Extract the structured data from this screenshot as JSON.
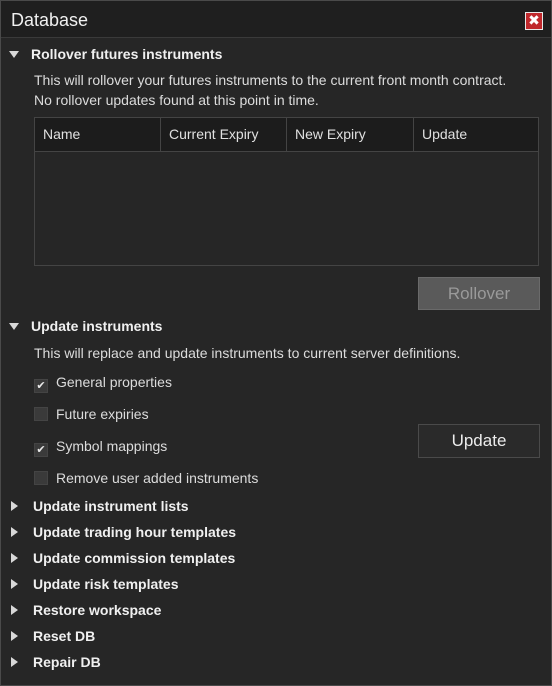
{
  "window": {
    "title": "Database",
    "close_glyph": "✖"
  },
  "rollover": {
    "header": "Rollover futures instruments",
    "desc1": "This will rollover your futures instruments to the current front month contract.",
    "desc2": "No rollover updates found at this point in time.",
    "columns": [
      "Name",
      "Current Expiry",
      "New Expiry",
      "Update"
    ],
    "rows": [],
    "button": "Rollover"
  },
  "update_instruments": {
    "header": "Update instruments",
    "desc": "This will replace and update instruments to current server definitions.",
    "options": [
      {
        "label": "General properties",
        "checked": true
      },
      {
        "label": "Future expiries",
        "checked": false
      },
      {
        "label": "Symbol mappings",
        "checked": true
      },
      {
        "label": "Remove user added instruments",
        "checked": false
      }
    ],
    "button": "Update"
  },
  "collapsed_sections": [
    "Update instrument lists",
    "Update trading hour templates",
    "Update commission templates",
    "Update risk templates",
    "Restore workspace",
    "Reset DB",
    "Repair DB"
  ],
  "colors": {
    "background": "#262626",
    "close": "#c0282c",
    "disabled_button": "#5a5a5a"
  },
  "icons": {
    "close": "close-icon",
    "expanded": "triangle-down-icon",
    "collapsed": "triangle-right-icon",
    "check": "checkmark-icon"
  }
}
